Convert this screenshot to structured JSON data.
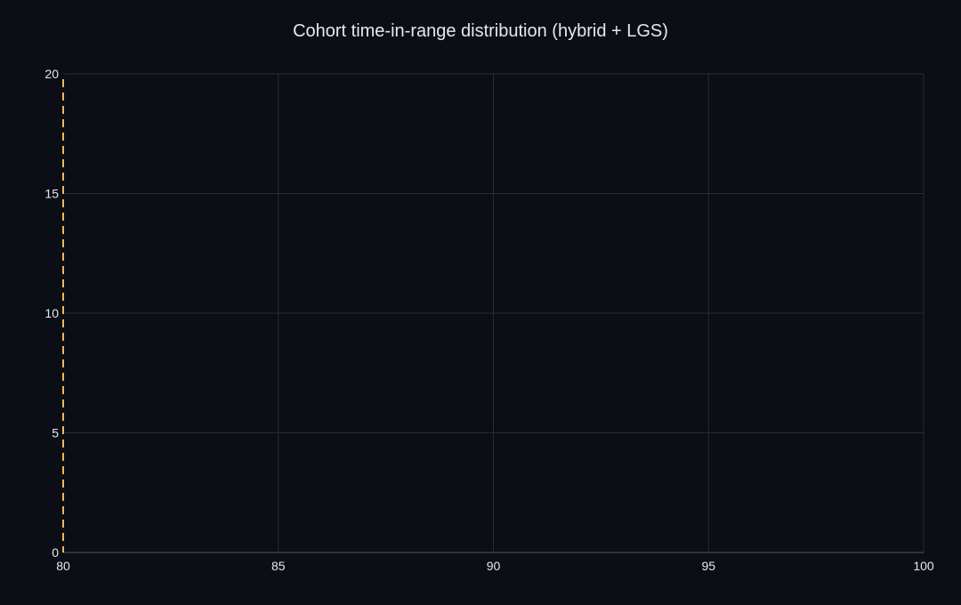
{
  "chart_data": {
    "type": "bar",
    "title": "Cohort time-in-range distribution (hybrid + LGS)",
    "xlabel": "",
    "ylabel": "",
    "xlim": [
      80,
      100
    ],
    "ylim": [
      0,
      20
    ],
    "x_ticks": [
      80,
      85,
      90,
      95,
      100
    ],
    "y_ticks": [
      0,
      5,
      10,
      15,
      20
    ],
    "grid": true,
    "legend": "none",
    "series": [],
    "reference_lines": [
      {
        "axis": "x",
        "value": 80,
        "style": "dashed",
        "color": "#f5b94e"
      }
    ]
  },
  "colors": {
    "background": "#0b0e15",
    "text": "#e6e8ee",
    "grid": "#262b36",
    "threshold": "#f5b94e"
  }
}
